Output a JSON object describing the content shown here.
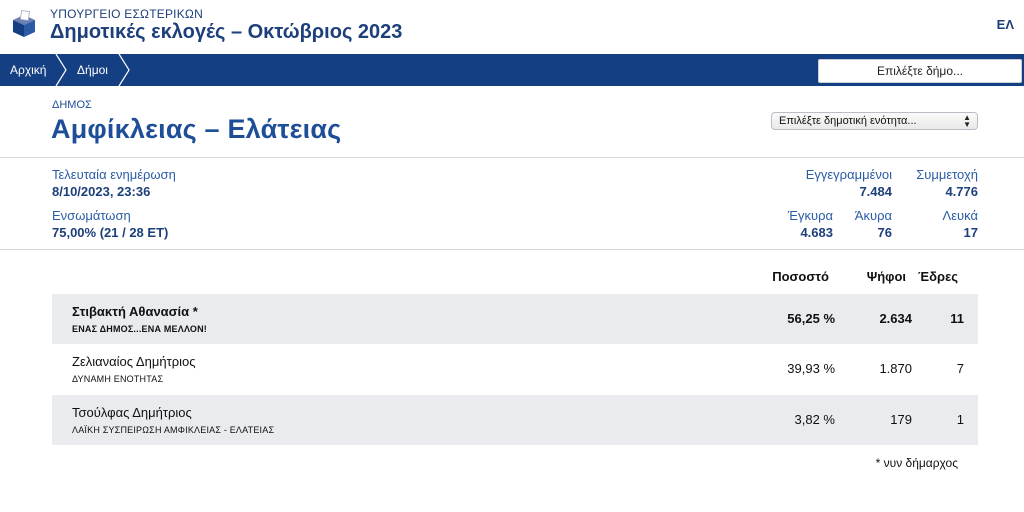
{
  "header": {
    "ministry": "ΥΠΟΥΡΓΕΙΟ ΕΣΩΤΕΡΙΚΩΝ",
    "title": "Δημοτικές εκλογές – Οκτώβριος 2023",
    "lang": "ΕΛ",
    "logo_icon": "ballot-box-icon"
  },
  "nav": {
    "home": "Αρχική",
    "municipalities": "Δήμοι",
    "select_municipality": "Επιλέξτε δήμο..."
  },
  "municipality": {
    "label": "ΔΗΜΟΣ",
    "name": "Αμφίκλειας – Ελάτειας",
    "unit_select": "Επιλέξτε δημοτική ενότητα..."
  },
  "stats": {
    "last_update_label": "Τελευταία ενημέρωση",
    "last_update_value": "8/10/2023, 23:36",
    "integration_label": "Ενσωμάτωση",
    "integration_value": "75,00% (21 / 28 ΕΤ)",
    "registered_label": "Εγγεγραμμένοι",
    "registered_value": "7.484",
    "turnout_label": "Συμμετοχή",
    "turnout_value": "4.776",
    "valid_label": "Έγκυρα",
    "valid_value": "4.683",
    "invalid_label": "Άκυρα",
    "invalid_value": "76",
    "blank_label": "Λευκά",
    "blank_value": "17"
  },
  "results": {
    "headers": {
      "percent": "Ποσοστό",
      "votes": "Ψήφοι",
      "seats": "Έδρες"
    },
    "rows": [
      {
        "candidate": "Στιβακτή Αθανασία *",
        "party": "ΕΝΑΣ ΔΗΜΟΣ...ΕΝΑ ΜΕΛΛΟΝ!",
        "percent": "56,25 %",
        "votes": "2.634",
        "seats": "11"
      },
      {
        "candidate": "Ζελιαναίος Δημήτριος",
        "party": "ΔΥΝΑΜΗ ΕΝΟΤΗΤΑΣ",
        "percent": "39,93 %",
        "votes": "1.870",
        "seats": "7"
      },
      {
        "candidate": "Τσούλφας Δημήτριος",
        "party": "ΛΑΪΚΗ ΣΥΣΠΕΙΡΩΣΗ ΑΜΦΙΚΛΕΙΑΣ - ΕΛΑΤΕΙΑΣ",
        "percent": "3,82 %",
        "votes": "179",
        "seats": "1"
      }
    ],
    "footnote": "* νυν δήμαρχος"
  },
  "colors": {
    "primary": "#143f83",
    "title": "#1d4e97",
    "row_shade": "#e9ebef"
  }
}
